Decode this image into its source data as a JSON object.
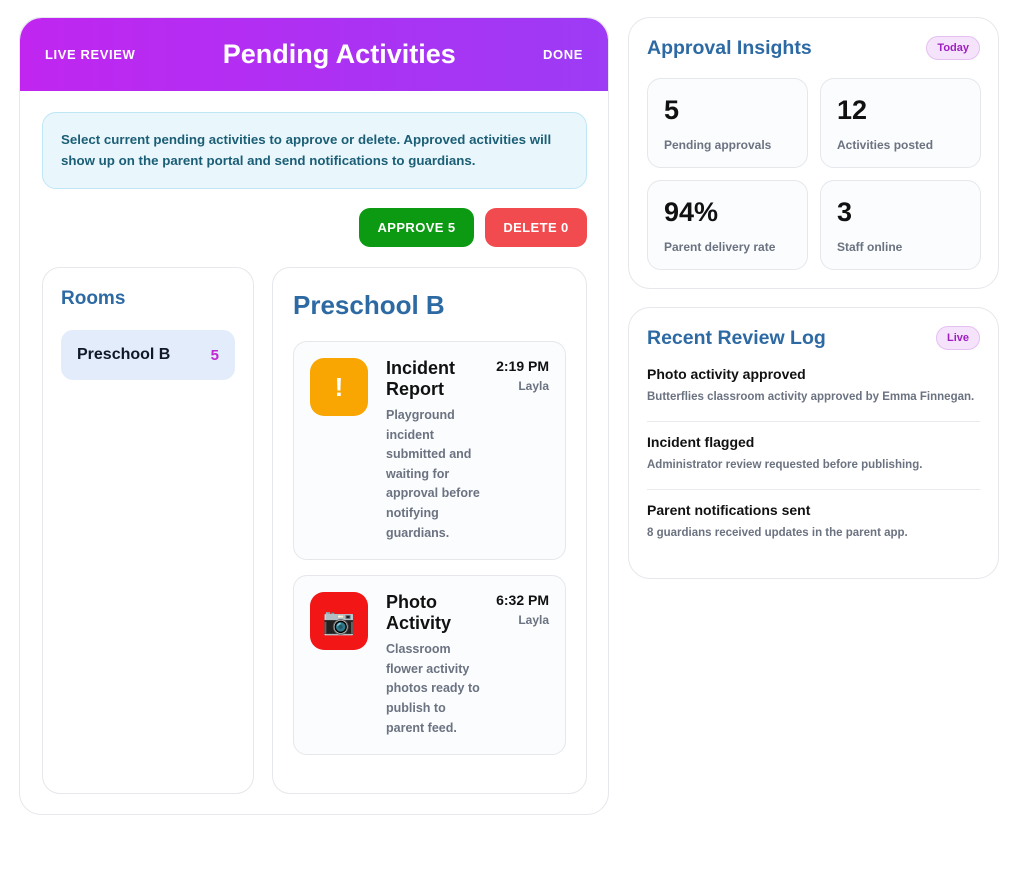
{
  "header": {
    "left_label": "LIVE REVIEW",
    "title": "Pending Activities",
    "right_label": "DONE"
  },
  "info": {
    "text": "Select current pending activities to approve or delete. Approved activities will show up on the parent portal and send notifications to guardians."
  },
  "actions": {
    "approve_label": "APPROVE 5",
    "delete_label": "DELETE 0"
  },
  "rooms": {
    "title": "Rooms",
    "items": [
      {
        "name": "Preschool B",
        "count": "5"
      }
    ]
  },
  "room_detail": {
    "heading": "Preschool B",
    "activities": [
      {
        "name": "Incident Report",
        "time": "2:19 PM",
        "user": "Layla",
        "description": "Playground incident submitted and waiting for approval before notifying guardians.",
        "icon": "exclamation-icon",
        "icon_glyph": "!",
        "icon_color": "#f9a602"
      },
      {
        "name": "Photo Activity",
        "time": "6:32 PM",
        "user": "Layla",
        "description": "Classroom flower activity photos ready to publish to parent feed.",
        "icon": "camera-icon",
        "icon_glyph": "📷",
        "icon_color": "#f21616"
      }
    ]
  },
  "insights": {
    "title": "Approval Insights",
    "badge": "Today",
    "stats": [
      {
        "value": "5",
        "label": "Pending approvals"
      },
      {
        "value": "12",
        "label": "Activities posted"
      },
      {
        "value": "94%",
        "label": "Parent delivery rate"
      },
      {
        "value": "3",
        "label": "Staff online"
      }
    ]
  },
  "review_log": {
    "title": "Recent Review Log",
    "badge": "Live",
    "items": [
      {
        "title": "Photo activity approved",
        "description": "Butterflies classroom activity approved by Emma Finnegan."
      },
      {
        "title": "Incident flagged",
        "description": "Administrator review requested before publishing."
      },
      {
        "title": "Parent notifications sent",
        "description": "8 guardians received updates in the parent app."
      }
    ]
  },
  "colors": {
    "header_gradient_start": "#c026f0",
    "header_gradient_end": "#9d3bf5",
    "approve": "#0b9a12",
    "delete": "#f24b4f",
    "section_title": "#2d6aa3",
    "room_count": "#c026d3"
  }
}
